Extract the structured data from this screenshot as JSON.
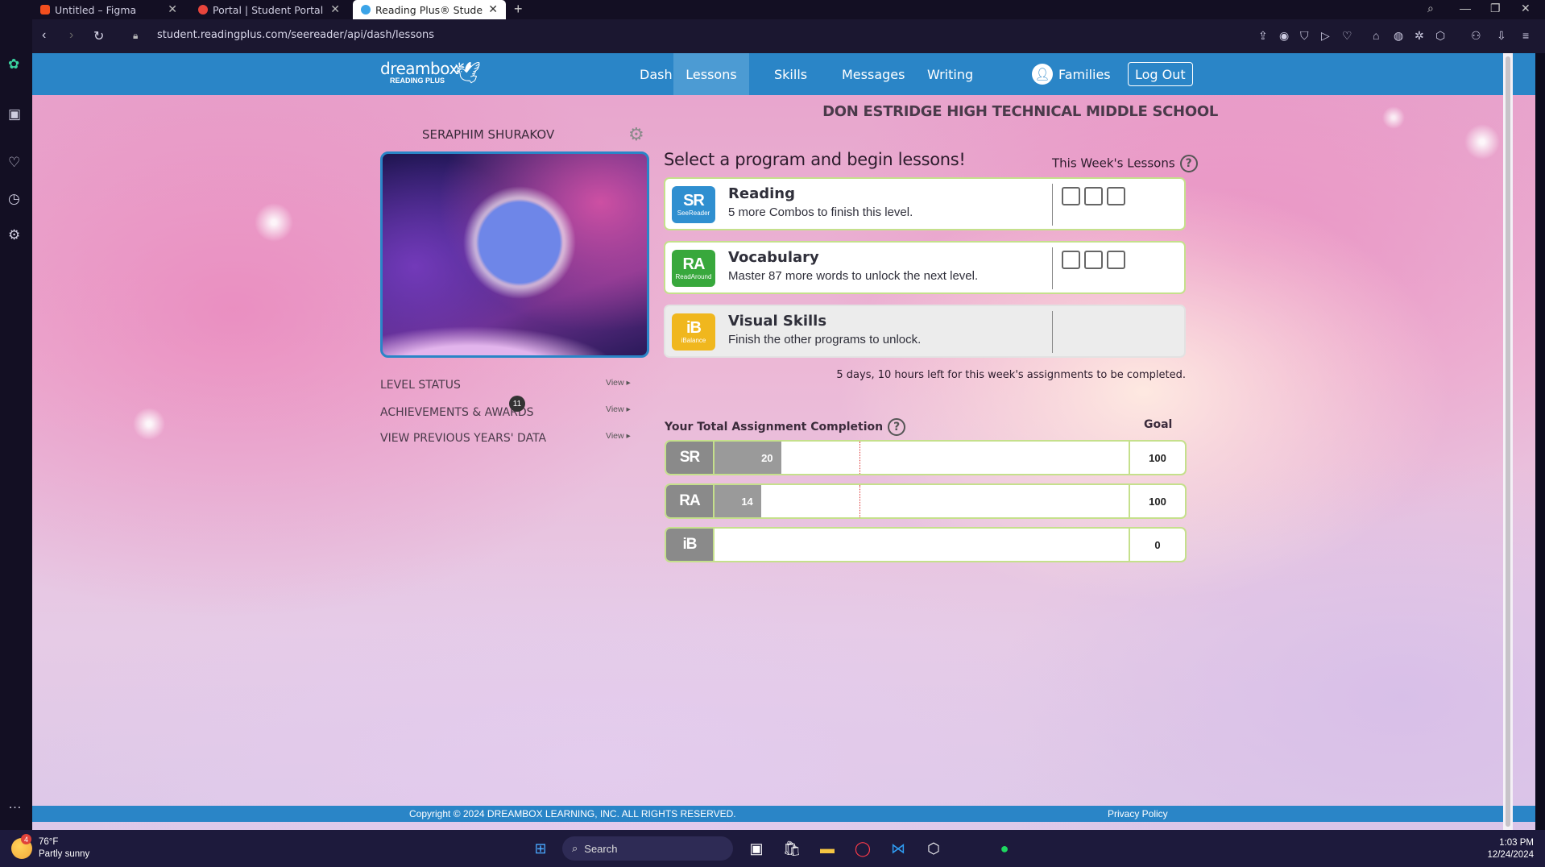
{
  "browser": {
    "tabs": [
      {
        "title": "Untitled – Figma",
        "color": "#f24e1e"
      },
      {
        "title": "Portal | Student Portal",
        "color": "#e8453c"
      },
      {
        "title": "Reading Plus® Student Da",
        "color": "#3ba4e8"
      }
    ],
    "url": "student.readingplus.com/seereader/api/dash/lessons"
  },
  "nav": {
    "logo_line1": "dreambox",
    "logo_line2": "READING PLUS",
    "links": [
      "Dashboard",
      "Lessons",
      "Skills",
      "Messages",
      "Writing"
    ],
    "active": "Lessons",
    "families": "Families",
    "logout": "Log Out"
  },
  "school": "DON ESTRIDGE HIGH TECHNICAL MIDDLE SCHOOL",
  "student": "SERAPHIM SHURAKOV",
  "side_links": [
    {
      "label": "LEVEL STATUS",
      "view": "View ▸"
    },
    {
      "label": "ACHIEVEMENTS & AWARDS",
      "view": "View ▸"
    },
    {
      "label": "VIEW PREVIOUS YEARS' DATA",
      "view": "View ▸"
    }
  ],
  "achievements_badge": "11",
  "lessons": {
    "heading": "Select a program and begin lessons!",
    "week_label": "This Week's Lessons",
    "programs": [
      {
        "code": "SR",
        "sub": "SeeReader",
        "title": "Reading",
        "desc": "5 more Combos to finish this level.",
        "color": "#2f8fd0",
        "boxes": 3
      },
      {
        "code": "RA",
        "sub": "ReadAround",
        "title": "Vocabulary",
        "desc": "Master 87 more words to unlock the next level.",
        "color": "#38a83c",
        "boxes": 3
      },
      {
        "code": "iB",
        "sub": "iBalance",
        "title": "Visual Skills",
        "desc": "Finish the other programs to unlock.",
        "color": "#f0b71e",
        "boxes": 0
      }
    ],
    "time_left": "5 days, 10 hours left for this week's assignments to be completed."
  },
  "completion": {
    "heading": "Your Total Assignment Completion",
    "goal_label": "Goal",
    "rows": [
      {
        "code": "SR",
        "value": 20,
        "goal": 100,
        "value_label": "20",
        "goal_label": "100",
        "target": 0.4
      },
      {
        "code": "RA",
        "value": 14,
        "goal": 100,
        "value_label": "14",
        "goal_label": "100",
        "target": 0.4
      },
      {
        "code": "iB",
        "value": 0,
        "goal": 0,
        "value_label": "",
        "goal_label": "0",
        "target": null
      }
    ]
  },
  "footer": {
    "copyright": "Copyright © 2024 DREAMBOX LEARNING, INC. ALL RIGHTS RESERVED.",
    "privacy": "Privacy Policy"
  },
  "taskbar": {
    "temp": "76°F",
    "weather": "Partly sunny",
    "weather_badge": "4",
    "search": "Search",
    "time": "1:03 PM",
    "date": "12/24/2024"
  }
}
